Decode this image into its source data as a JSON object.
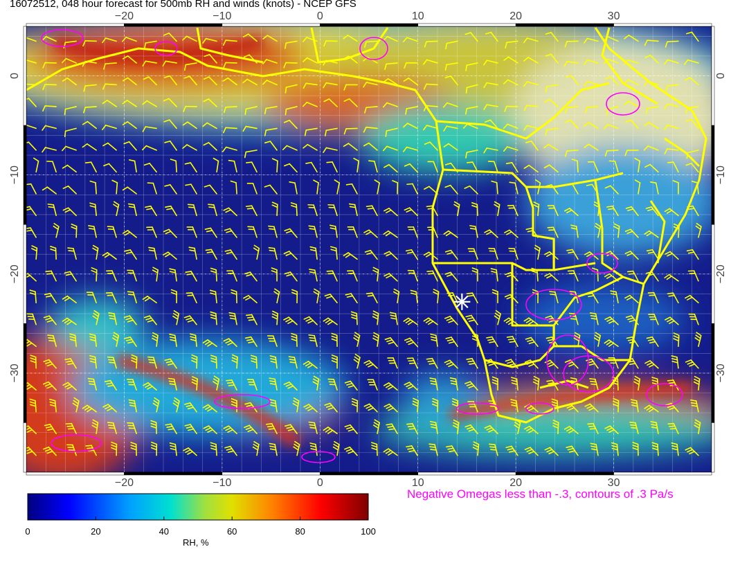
{
  "title": "16072512, 048 hour forecast for 500mb RH and winds (knots) - NCEP GFS",
  "map": {
    "lon_range": [
      -30,
      40
    ],
    "lat_range": [
      -40,
      5
    ],
    "lon_ticks": [
      {
        "value": -20,
        "label": "−20"
      },
      {
        "value": -10,
        "label": "−10"
      },
      {
        "value": 0,
        "label": "0"
      },
      {
        "value": 10,
        "label": "10"
      },
      {
        "value": 20,
        "label": "20"
      },
      {
        "value": 30,
        "label": "30"
      }
    ],
    "lat_ticks": [
      {
        "value": 0,
        "label": "0"
      },
      {
        "value": -10,
        "label": "−10"
      },
      {
        "value": -20,
        "label": "−20"
      },
      {
        "value": -30,
        "label": "−30"
      }
    ],
    "grid": true,
    "marker": {
      "symbol": "star",
      "lon": 14.5,
      "lat": -22.8
    },
    "colors": {
      "ocean_low_rh": "#141c8c",
      "high_rh": "#d23a1a",
      "coastline": "#ffff00",
      "wind_barbs": "#ffff00",
      "omega_contours": "#ff00ff",
      "marker": "#ffffff"
    }
  },
  "omega_note": "Negative Omegas less than -.3, contours of .3 Pa/s",
  "colorbar": {
    "label": "RH, %",
    "range": [
      0,
      100
    ],
    "ticks": [
      "0",
      "20",
      "40",
      "60",
      "80",
      "100"
    ],
    "stops": [
      "#00007f",
      "#0000ff",
      "#00a0ff",
      "#00e0d0",
      "#a0e040",
      "#e0e000",
      "#ff8000",
      "#ff0000",
      "#7f0000"
    ]
  }
}
